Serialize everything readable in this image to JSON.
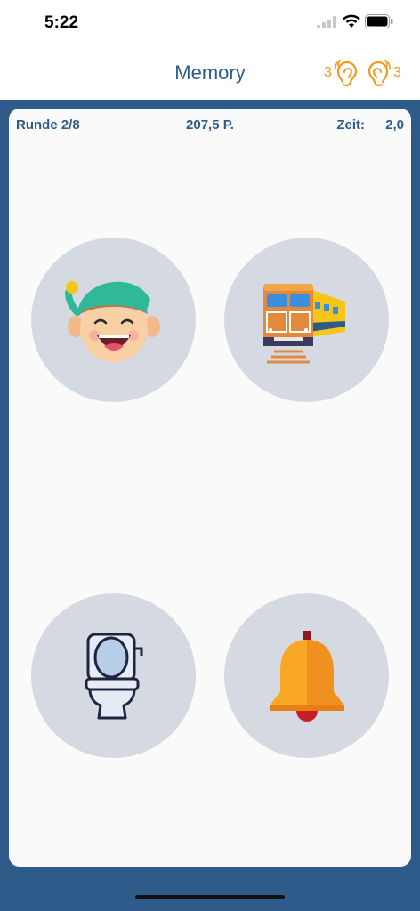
{
  "status": {
    "time": "5:22"
  },
  "nav": {
    "title": "Memory",
    "left_count": "3",
    "right_count": "3"
  },
  "game": {
    "round": "Runde 2/8",
    "points": "207,5 P.",
    "time_label": "Zeit:",
    "time_value": "2,0"
  },
  "cards": [
    {
      "icon": "elf-icon"
    },
    {
      "icon": "train-icon"
    },
    {
      "icon": "toilet-icon"
    },
    {
      "icon": "bell-icon"
    }
  ],
  "colors": {
    "accent": "#2b5c8a",
    "frame": "#2f5b8a",
    "card_bg": "#d5dae2",
    "ear": "#f29a1e"
  }
}
